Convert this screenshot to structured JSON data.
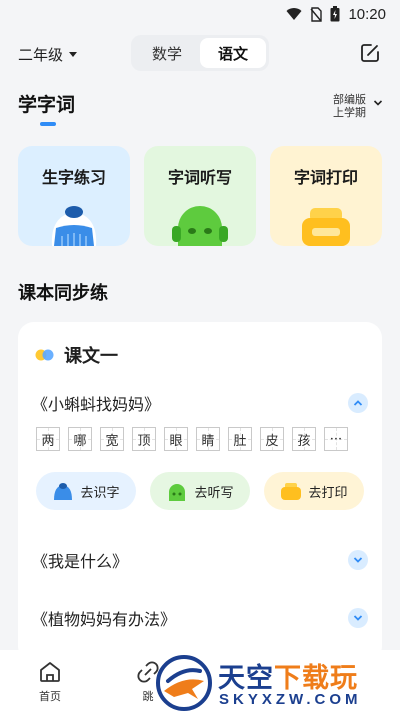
{
  "status_bar": {
    "time": "10:20"
  },
  "header": {
    "grade": "二年级",
    "subjects": [
      {
        "label": "数学",
        "active": false
      },
      {
        "label": "语文",
        "active": true
      }
    ]
  },
  "words_section": {
    "title": "学字词",
    "edition_line1": "部编版",
    "edition_line2": "上学期",
    "tools": [
      {
        "label": "生字练习",
        "bg": "#dcefff"
      },
      {
        "label": "字词听写",
        "bg": "#e3f7df"
      },
      {
        "label": "字词打印",
        "bg": "#fff3d2"
      }
    ]
  },
  "sync_section": {
    "title": "课本同步练",
    "lesson": {
      "title": "课文一",
      "texts": [
        {
          "title": "《小蝌蚪找妈妈》",
          "expanded": true
        },
        {
          "title": "《我是什么》",
          "expanded": false
        },
        {
          "title": "《植物妈妈有办法》",
          "expanded": false
        }
      ],
      "characters": [
        "两",
        "哪",
        "宽",
        "顶",
        "眼",
        "睛",
        "肚",
        "皮",
        "孩",
        "···"
      ],
      "actions": [
        {
          "label": "去识字",
          "bg": "#e6f2ff"
        },
        {
          "label": "去听写",
          "bg": "#e6f7e2"
        },
        {
          "label": "去打印",
          "bg": "#fff4d6"
        }
      ]
    }
  },
  "bottom_nav": [
    {
      "label": "首页",
      "icon": "home-icon"
    },
    {
      "label": "跳",
      "icon": "link-icon"
    }
  ],
  "watermark": {
    "brand_a": "天空",
    "brand_b": "下载玩",
    "url": "SKYXZW.COM"
  },
  "colors": {
    "accent": "#2f8cf6",
    "background": "#f4f5f7"
  }
}
